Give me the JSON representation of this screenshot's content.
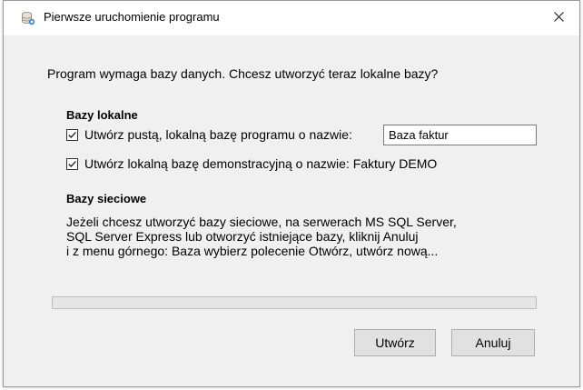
{
  "window": {
    "title": "Pierwsze uruchomienie programu",
    "icon": "database-icon",
    "close_glyph": "✕"
  },
  "question": "Program wymaga bazy danych. Chcesz utworzyć teraz lokalne bazy?",
  "local": {
    "heading": "Bazy lokalne",
    "empty_db": {
      "label": "Utwórz pustą, lokalną bazę programu o nazwie:",
      "checked": true,
      "name_value": "Baza faktur"
    },
    "demo_db": {
      "label": "Utwórz lokalną bazę demonstracyjną o nazwie: Faktury DEMO",
      "checked": true
    }
  },
  "network": {
    "heading": "Bazy sieciowe",
    "lines": [
      "Jeżeli chcesz utworzyć bazy sieciowe, na serwerach  MS SQL Server,",
      "SQL Server Express lub otworzyć istniejące bazy, kliknij Anuluj",
      "i z menu górnego: Baza wybierz polecenie Otwórz, utwórz nową..."
    ]
  },
  "progress": {
    "value": 0
  },
  "buttons": {
    "create_label": "Utwórz",
    "cancel_label": "Anuluj"
  },
  "colors": {
    "window_bg": "#f0f0f0",
    "titlebar_bg": "#ffffff",
    "button_bg": "#e1e1e1",
    "progress_track": "#e6e6e6"
  }
}
